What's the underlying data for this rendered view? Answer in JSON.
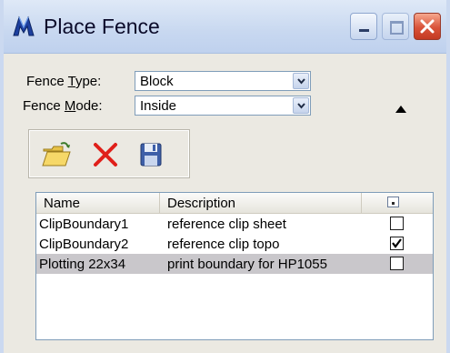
{
  "window": {
    "title": "Place Fence",
    "controls": [
      "minimize-icon",
      "maximize-icon",
      "close-icon"
    ]
  },
  "fence_type": {
    "label_prefix": "Fence ",
    "label_hotkey": "T",
    "label_suffix": "ype:",
    "value": "Block"
  },
  "fence_mode": {
    "label_prefix": "Fence ",
    "label_hotkey": "M",
    "label_suffix": "ode:",
    "value": "Inside"
  },
  "toolbar": {
    "buttons": [
      "open-folder-icon",
      "delete-x-icon",
      "save-disk-icon"
    ]
  },
  "list": {
    "columns": {
      "name": "Name",
      "description": "Description",
      "visible": "display-toggle-icon"
    },
    "rows": [
      {
        "name": "ClipBoundary1",
        "description": "reference clip sheet",
        "checked": false,
        "selected": false
      },
      {
        "name": "ClipBoundary2",
        "description": "reference clip topo",
        "checked": true,
        "selected": false
      },
      {
        "name": "Plotting 22x34",
        "description": "print boundary for HP1055",
        "checked": false,
        "selected": true
      }
    ]
  },
  "colors": {
    "title_bar": "#c8d8f0",
    "dialog_bg": "#ebe9e2",
    "close_button": "#d9533a",
    "selected_row": "#c9c7cb",
    "delete_icon": "#e0201a"
  }
}
